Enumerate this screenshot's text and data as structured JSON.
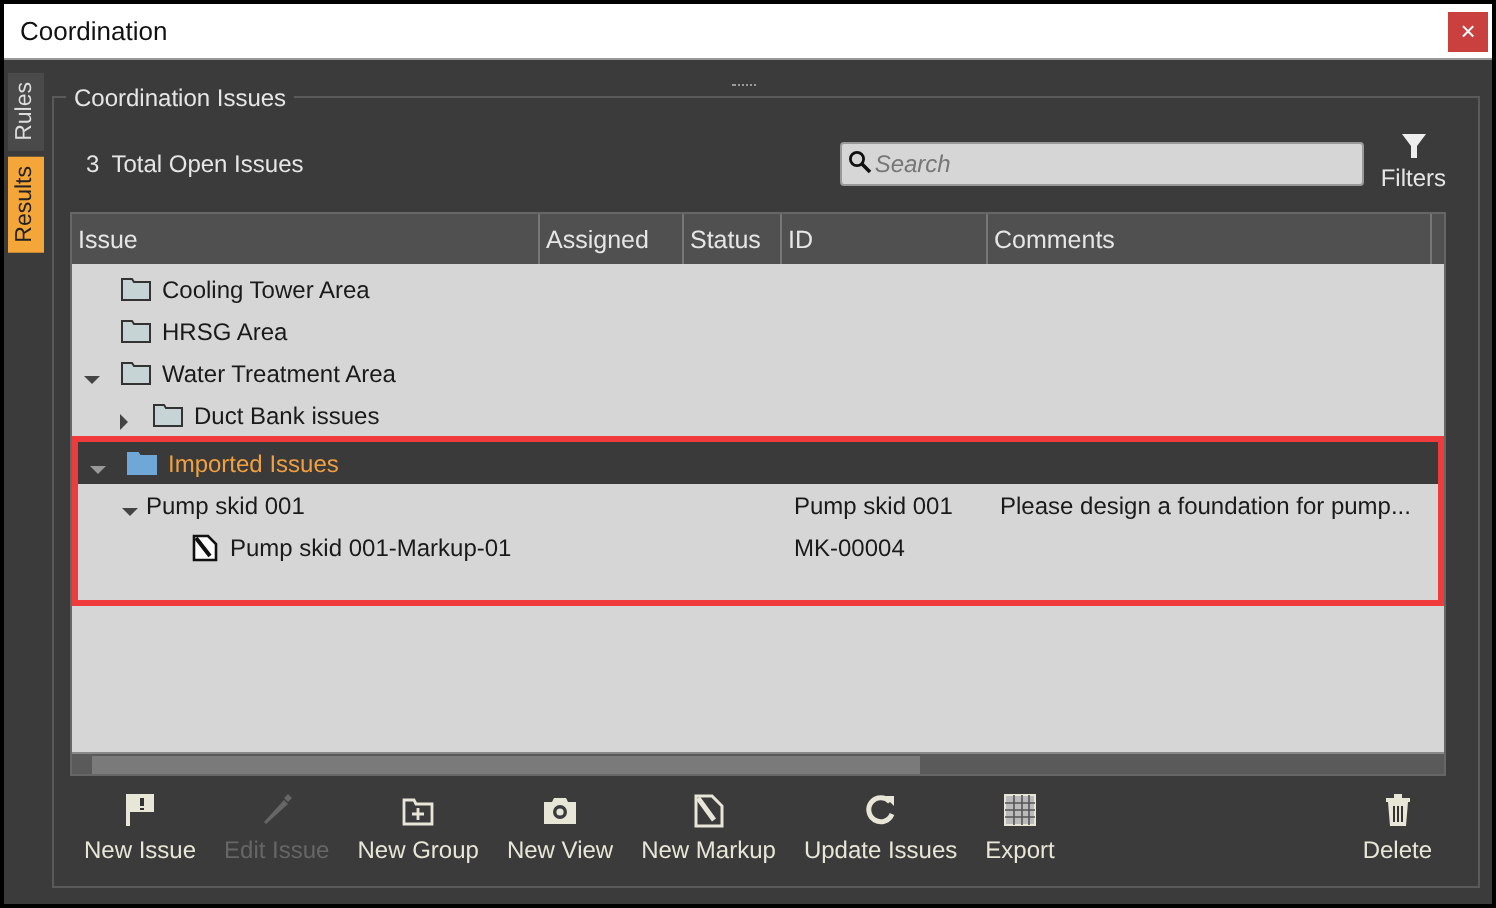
{
  "window": {
    "title": "Coordination",
    "close": "×"
  },
  "side_tabs": [
    {
      "label": "Rules",
      "selected": false
    },
    {
      "label": "Results",
      "selected": true
    }
  ],
  "panel": {
    "title": "Coordination Issues",
    "count": "3",
    "count_label": "Total Open Issues",
    "search": {
      "placeholder": "Search"
    },
    "filters_button": "Filters"
  },
  "table": {
    "columns": [
      "Issue",
      "Assigned",
      "Status",
      "ID",
      "Comments"
    ],
    "rows": [
      {
        "kind": "folder",
        "label": "Cooling Tower Area",
        "selected": false
      },
      {
        "kind": "folder",
        "label": "HRSG Area",
        "selected": false
      },
      {
        "kind": "folder",
        "label": "Water Treatment Area",
        "selected": false,
        "expanded": true,
        "children": [
          {
            "kind": "folder",
            "label": "Duct Bank issues",
            "selected": false,
            "expanded": false
          }
        ]
      },
      {
        "kind": "folder",
        "label": "Imported Issues",
        "selected": true,
        "highlighted": true,
        "expanded": true,
        "children": [
          {
            "kind": "issue",
            "label": "Pump skid 001",
            "selected": false,
            "expanded": true,
            "id": "Pump skid 001",
            "comments": "Please design a foundation for pump...",
            "children": [
              {
                "kind": "markup",
                "label": "Pump skid 001-Markup-01",
                "selected": false,
                "id": "MK-00004"
              }
            ]
          }
        ]
      }
    ]
  },
  "toolbar": [
    {
      "kind": "flag",
      "label": "New Issue",
      "disabled": false
    },
    {
      "kind": "pencil",
      "label": "Edit Issue",
      "disabled": true
    },
    {
      "kind": "folder-plus",
      "label": "New Group",
      "disabled": false
    },
    {
      "kind": "camera",
      "label": "New View",
      "disabled": false
    },
    {
      "kind": "markup",
      "label": "New Markup",
      "disabled": false
    },
    {
      "kind": "refresh",
      "label": "Update Issues",
      "disabled": false
    },
    {
      "kind": "grid",
      "label": "Export",
      "disabled": false
    },
    {
      "kind": "trash",
      "label": "Delete",
      "disabled": false
    }
  ]
}
